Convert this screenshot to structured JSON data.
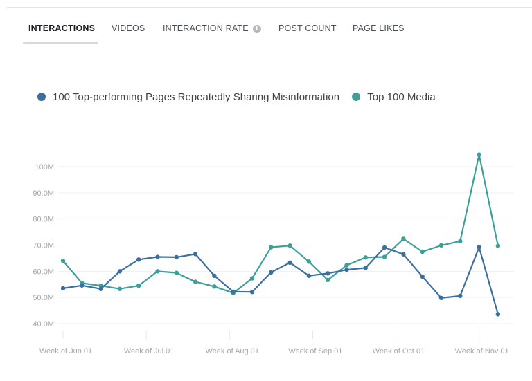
{
  "tabs": [
    {
      "label": "INTERACTIONS",
      "active": true
    },
    {
      "label": "VIDEOS",
      "active": false
    },
    {
      "label": "INTERACTION RATE",
      "active": false,
      "info_icon": "info-icon"
    },
    {
      "label": "POST COUNT",
      "active": false
    },
    {
      "label": "PAGE LIKES",
      "active": false
    }
  ],
  "chart_data": {
    "type": "line",
    "legend_placement": "top-left",
    "grid": true,
    "x_tick_labels": [
      "Week of Jun 01",
      "Week of Jul 01",
      "Week of Aug 01",
      "Week of Sep 01",
      "Week of Oct 01",
      "Week of Nov 01"
    ],
    "y_tick_labels": [
      "40.0M",
      "50.0M",
      "60.0M",
      "70.0M",
      "80.0M",
      "90.0M",
      "100M"
    ],
    "ylim": [
      40,
      100
    ],
    "y_unit": "M",
    "series": [
      {
        "name": "100 Top-performing Pages Repeatedly Sharing Misinformation",
        "color": "#3c6f9e",
        "values": [
          53.5,
          54.6,
          53.3,
          60.0,
          64.5,
          65.5,
          65.4,
          66.6,
          58.3,
          52.2,
          52.1,
          59.6,
          63.3,
          58.3,
          59.2,
          60.6,
          61.3,
          69.1,
          66.5,
          58.0,
          49.8,
          50.6,
          69.2,
          43.6
        ]
      },
      {
        "name": "Top 100 Media",
        "color": "#3d9f99",
        "values": [
          64.0,
          55.5,
          54.5,
          53.3,
          54.5,
          60.0,
          59.4,
          56.0,
          54.2,
          51.7,
          57.3,
          69.2,
          69.8,
          63.7,
          56.7,
          62.3,
          65.3,
          65.5,
          72.4,
          67.5,
          69.9,
          71.5,
          104.6,
          69.7
        ]
      }
    ]
  }
}
